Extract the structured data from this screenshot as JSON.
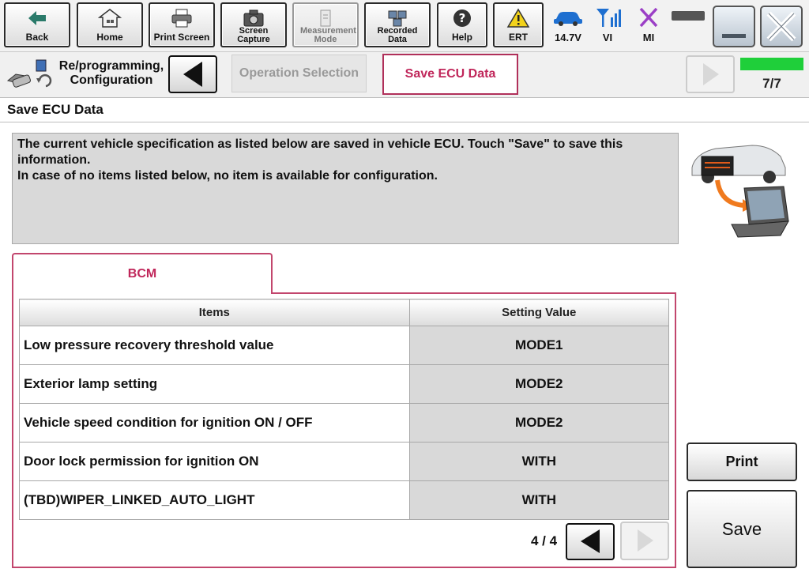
{
  "toolbar": {
    "back_label": "Back",
    "home_label": "Home",
    "print_screen_label": "Print Screen",
    "screen_capture_label": "Screen Capture",
    "measurement_mode_label": "Measurement Mode",
    "recorded_data_label": "Recorded Data",
    "help_label": "Help",
    "ert_label": "ERT",
    "voltage_label": "14.7V",
    "vi_label": "VI",
    "mi_label": "MI"
  },
  "breadcrumb": {
    "title": "Re/programming, Configuration",
    "step_prev_label": "Operation Selection",
    "step_current_label": "Save ECU Data",
    "progress_fraction": 1.0,
    "step_count": "7/7"
  },
  "page": {
    "title": "Save ECU Data",
    "info_line1": "The current vehicle specification as listed below are saved in vehicle ECU. Touch \"Save\" to save this information.",
    "info_line2": "In case of no items listed below, no item is available for configuration."
  },
  "tab": {
    "label": "BCM"
  },
  "table": {
    "headers": [
      "Items",
      "Setting Value"
    ],
    "rows": [
      {
        "item": "Low pressure recovery threshold value",
        "value": "MODE1"
      },
      {
        "item": "Exterior lamp setting",
        "value": "MODE2"
      },
      {
        "item": "Vehicle speed condition for ignition ON / OFF",
        "value": "MODE2"
      },
      {
        "item": "Door lock permission for ignition ON",
        "value": "WITH"
      },
      {
        "item": "(TBD)WIPER_LINKED_AUTO_LIGHT",
        "value": "WITH"
      }
    ]
  },
  "pager": {
    "label": "4 / 4"
  },
  "actions": {
    "print_label": "Print",
    "save_label": "Save"
  },
  "colors": {
    "accent": "#c0265a",
    "progress": "#1fcf3a",
    "value_cell": "#d9d9d9"
  }
}
